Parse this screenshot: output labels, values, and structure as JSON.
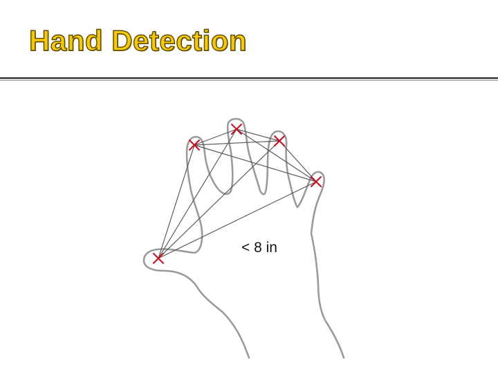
{
  "slide": {
    "title": "Hand Detection"
  },
  "diagram": {
    "distance_label": "< 8 in",
    "outline_color": "#9a9a9a",
    "line_color": "#5a5a5a",
    "marker_color": "#cc0a1a",
    "title_color": "#f6c900"
  }
}
